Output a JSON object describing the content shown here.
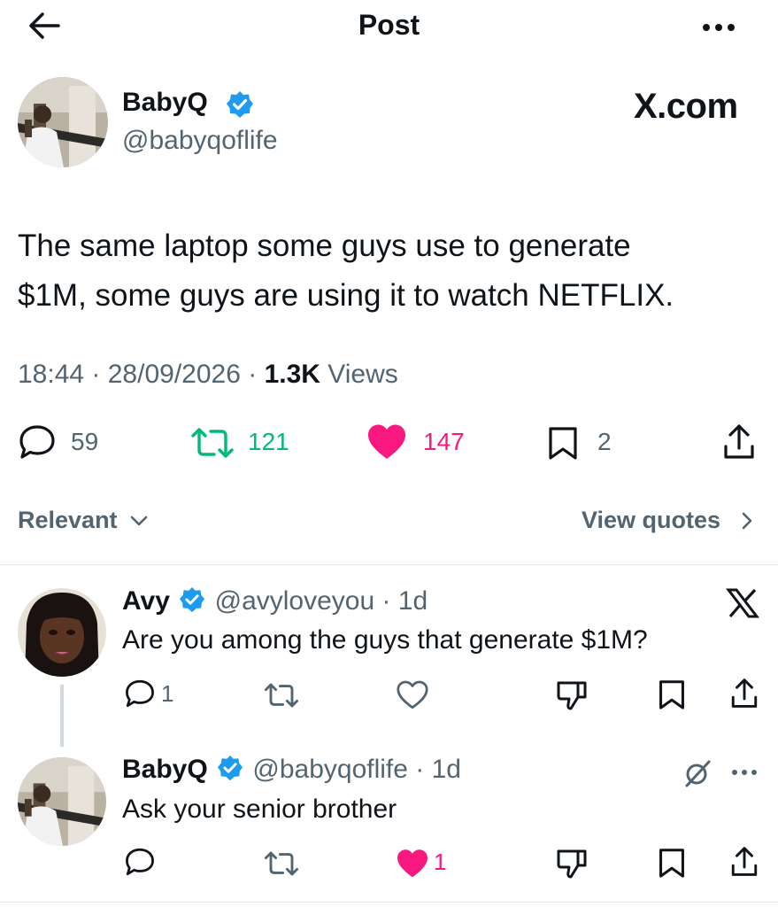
{
  "header": {
    "title": "Post"
  },
  "post": {
    "author_name": "BabyQ",
    "author_handle": "@babyqoflife",
    "source": "X.com",
    "text_line1": "The same laptop some guys use to generate",
    "text_line2": "$1M, some guys are using it to watch NETFLIX.",
    "time": "18:44",
    "date": "28/09/2026",
    "views_count": "1.3K",
    "views_label": "Views",
    "replies": "59",
    "reposts": "121",
    "likes": "147",
    "bookmarks": "2"
  },
  "filter": {
    "label": "Relevant",
    "view_quotes": "View quotes"
  },
  "replies": [
    {
      "name": "Avy",
      "handle": "@avyloveyou",
      "age": "1d",
      "text": "Are you among the guys that generate $1M?",
      "reply_count": "1",
      "like_count": ""
    },
    {
      "name": "BabyQ",
      "handle": "@babyqoflife",
      "age": "1d",
      "text": "Ask your senior brother",
      "reply_count": "",
      "like_count": "1"
    }
  ],
  "colors": {
    "verified": "#1d9bf0",
    "repost": "#00ba7c",
    "like": "#f91880",
    "text": "#0f1419",
    "muted": "#536471"
  }
}
